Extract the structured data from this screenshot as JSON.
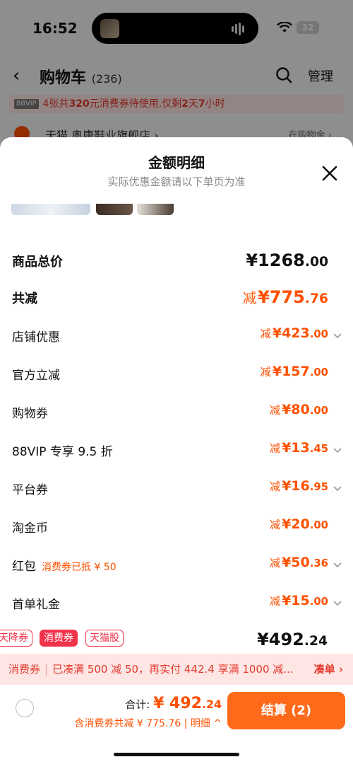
{
  "status": {
    "time": "16:52",
    "battery": "32"
  },
  "nav": {
    "back": "‹",
    "title": "购物车",
    "count": "(236)",
    "manage": "管理"
  },
  "promo_strip": {
    "vip": "88VIP",
    "prefix": "4张共",
    "amount": "320",
    "mid": "元消费券待使用,仅剩",
    "days": "2",
    "tail": "天",
    "hours": "7",
    "tail2": "小时"
  },
  "shop": {
    "name": "天猫 奥康鞋业旗舰店 ›",
    "right": "在购物金 ›"
  },
  "sheet": {
    "title": "金额明细",
    "subtitle": "实际优惠金额请以下单页为准",
    "rows": [
      {
        "label": "商品总价",
        "pre": "",
        "int": "¥1268",
        "dec": ".00"
      },
      {
        "label": "共减",
        "pre": "减",
        "int": "¥775",
        "dec": ".76"
      },
      {
        "label": "店铺优惠",
        "pre": "减",
        "int": "¥423",
        "dec": ".00"
      },
      {
        "label": "官方立减",
        "pre": "减",
        "int": "¥157",
        "dec": ".00"
      },
      {
        "label": "购物券",
        "pre": "减",
        "int": "¥80",
        "dec": ".00"
      },
      {
        "label": "88VIP 专享 9.5 折",
        "pre": "减",
        "int": "¥13",
        "dec": ".45"
      },
      {
        "label": "平台券",
        "pre": "减",
        "int": "¥16",
        "dec": ".95"
      },
      {
        "label": "淘金币",
        "pre": "减",
        "int": "¥20",
        "dec": ".00"
      },
      {
        "label": "红包",
        "sub": "消费券已抵 ¥ 50",
        "pre": "减",
        "int": "¥50",
        "dec": ".36"
      },
      {
        "label": "首单礼金",
        "pre": "减",
        "int": "¥15",
        "dec": ".00"
      }
    ],
    "tags": [
      "天降券",
      "消费券",
      "天猫股"
    ],
    "final_int": "¥492",
    "final_dec": ".24"
  },
  "banner": {
    "left": "消费券",
    "text": "已凑满 500 减 50，再实付 442.4 享满 1000 减...",
    "action": "凑单 ›"
  },
  "bottom": {
    "total_label": "合计: ",
    "total_int": "¥ 492",
    "total_dec": ".24",
    "discount": "含消费券共减 ¥ 775.76",
    "detail": "明细 ^",
    "checkout": "结算 (2)"
  },
  "colors": {
    "accent": "#ff5000",
    "checkout": "#ff6a1a",
    "tag": "#f0334a",
    "banner_bg": "#fde6e4"
  }
}
